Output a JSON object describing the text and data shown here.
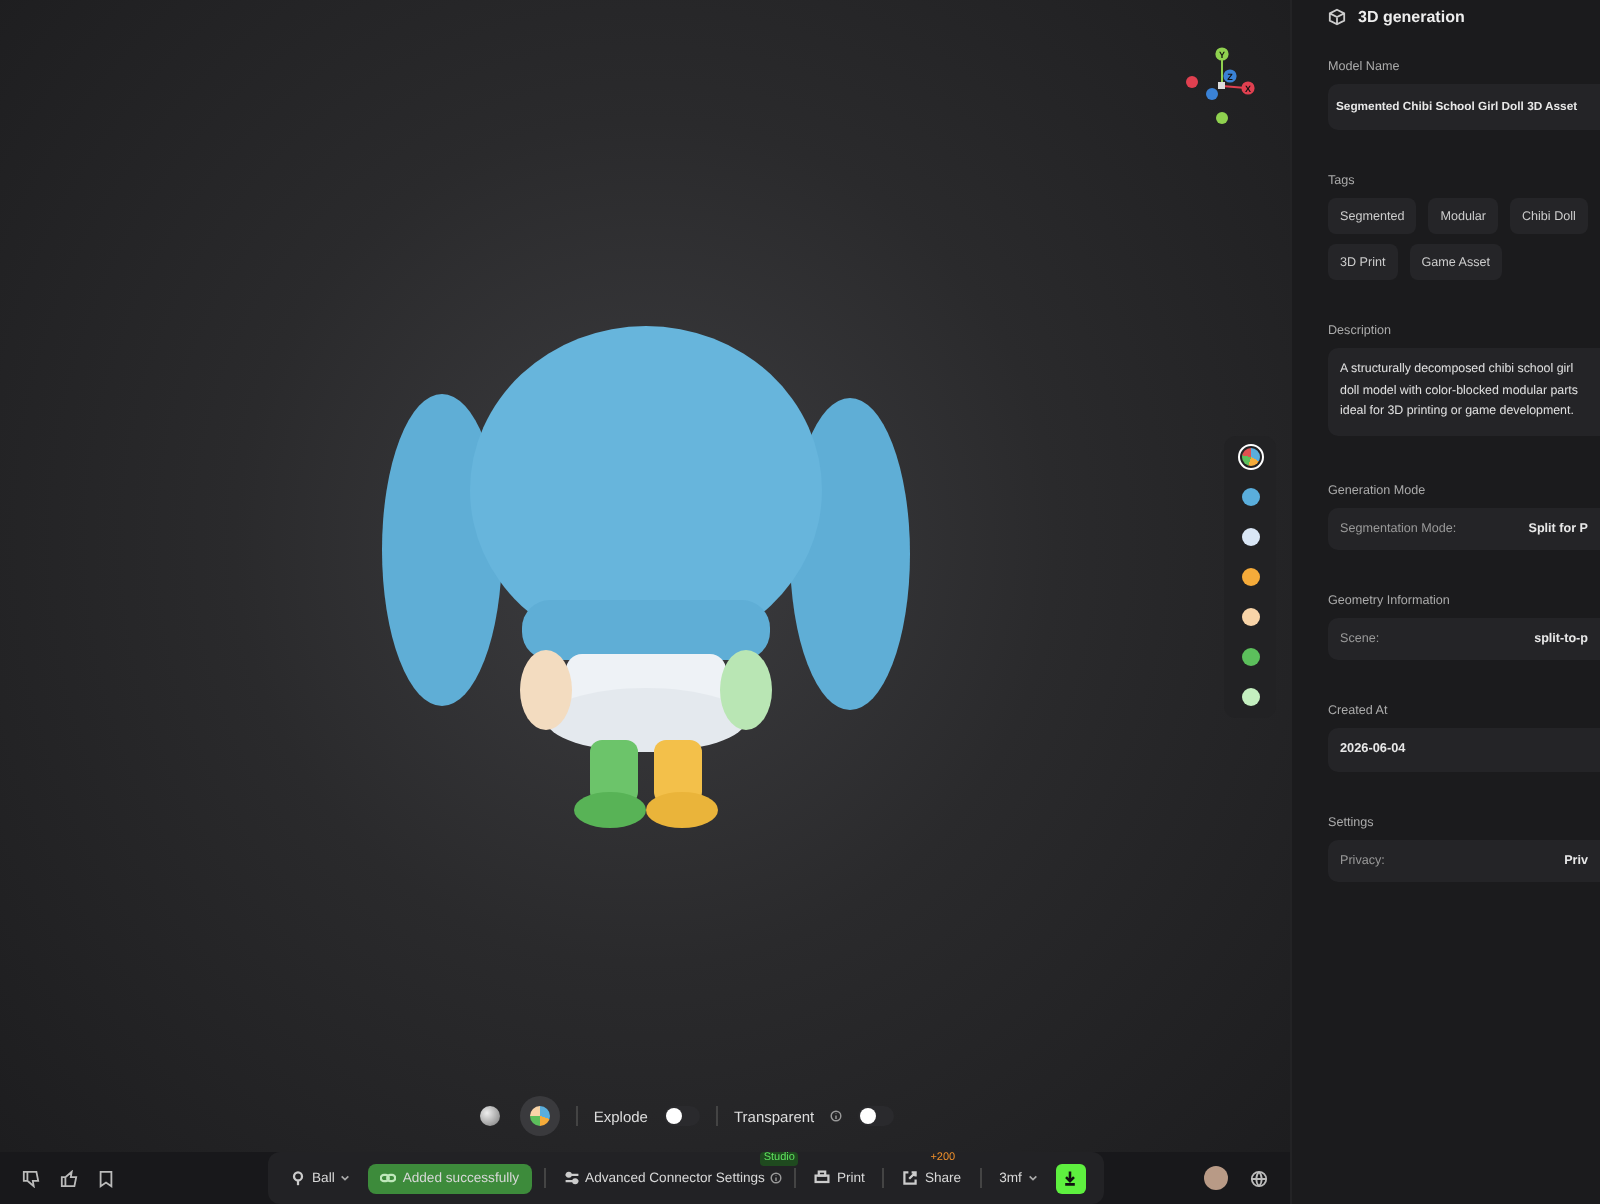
{
  "viewer": {
    "axis_labels": [
      "Y",
      "Z",
      "X"
    ],
    "palette": [
      {
        "kind": "mixed",
        "selected": true
      },
      {
        "kind": "solid",
        "color": "#5aaedc",
        "selected": false
      },
      {
        "kind": "solid",
        "color": "#d9e6f5",
        "selected": false
      },
      {
        "kind": "solid",
        "color": "#f5ab3a",
        "selected": false
      },
      {
        "kind": "solid",
        "color": "#f8d4a8",
        "selected": false
      },
      {
        "kind": "solid",
        "color": "#5cbf5c",
        "selected": false
      },
      {
        "kind": "solid",
        "color": "#c4efc0",
        "selected": false
      }
    ],
    "materials": [
      {
        "kind": "plain",
        "selected": false
      },
      {
        "kind": "color",
        "selected": true
      }
    ],
    "toggles": [
      {
        "label": "Explode",
        "on": false,
        "info": false
      },
      {
        "label": "Transparent",
        "on": false,
        "info": true
      }
    ]
  },
  "toolbar": {
    "items": [
      {
        "kind": "dropdown",
        "label": "Ball"
      },
      {
        "kind": "success",
        "label": "Added successfully"
      },
      {
        "kind": "settings",
        "label": "Advanced Connector Settings",
        "badge": "Studio"
      },
      {
        "kind": "print",
        "label": "Print"
      },
      {
        "kind": "share",
        "label": "Share",
        "badge": "+200"
      },
      {
        "kind": "format",
        "label": "3mf"
      },
      {
        "kind": "download"
      }
    ]
  },
  "panel": {
    "title": "3D generation",
    "sections": [
      {
        "kind": "field",
        "heading": "Model Name",
        "value": "Segmented Chibi School Girl Doll 3D Asset"
      },
      {
        "kind": "tags",
        "heading": "Tags",
        "tags": [
          "Segmented",
          "Modular",
          "Chibi Doll",
          "3D Print",
          "Game Asset"
        ]
      },
      {
        "kind": "paragraph",
        "heading": "Description",
        "lines": [
          "A structurally decomposed chibi school girl",
          "doll model with color-blocked modular parts",
          "ideal for 3D printing or game development."
        ]
      },
      {
        "kind": "pair",
        "heading": "Generation Mode",
        "label": "Segmentation Mode:",
        "value": "Split for P"
      },
      {
        "kind": "pair",
        "heading": "Geometry Information",
        "label": "Scene:",
        "value": "split-to-p"
      },
      {
        "kind": "field",
        "heading": "Created At",
        "value": "2026-06-04"
      },
      {
        "kind": "pair",
        "heading": "Settings",
        "label": "Privacy:",
        "value": "Priv"
      }
    ]
  }
}
